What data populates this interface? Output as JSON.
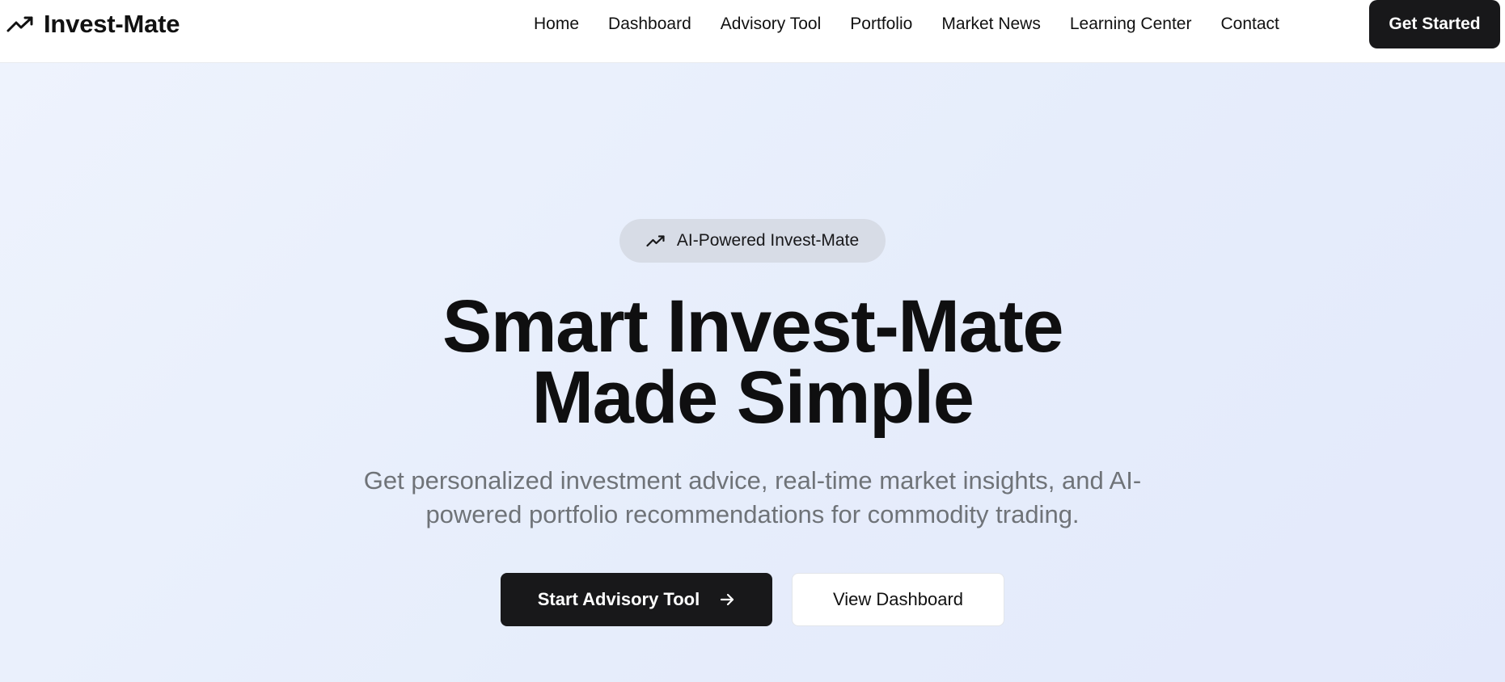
{
  "header": {
    "brand_icon": "trending-up-icon",
    "brand_name": "Invest-Mate",
    "nav": [
      "Home",
      "Dashboard",
      "Advisory Tool",
      "Portfolio",
      "Market News",
      "Learning Center",
      "Contact"
    ],
    "cta_label": "Get Started"
  },
  "hero": {
    "badge_icon": "trending-up-icon",
    "badge_text": "AI-Powered Invest-Mate",
    "headline_line1": "Smart Invest-Mate",
    "headline_line2": "Made Simple",
    "subtitle": "Get personalized investment advice, real-time market insights, and AI-powered portfolio recommendations for commodity trading.",
    "primary_button": "Start Advisory Tool",
    "primary_button_icon": "arrow-right-icon",
    "secondary_button": "View Dashboard"
  },
  "colors": {
    "accent_dark": "#18181a",
    "hero_bg": "#e8eefb",
    "badge_bg": "#d7dce6",
    "subtitle_text": "#6f7378"
  }
}
